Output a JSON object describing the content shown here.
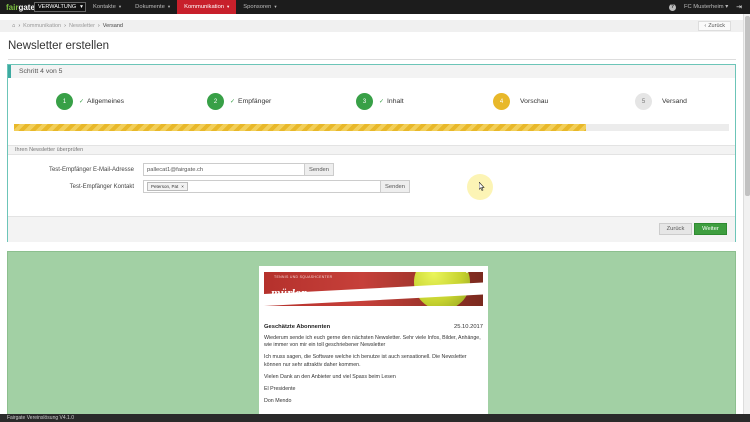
{
  "nav": {
    "logo_prefix": "fair",
    "logo_suffix": "gate",
    "module_select": "VERWALTUNG",
    "items": [
      {
        "label": "Kontakte"
      },
      {
        "label": "Dokumente"
      },
      {
        "label": "Kommunikation"
      },
      {
        "label": "Sponsoren"
      }
    ],
    "help_icon": "question-icon",
    "club": "FC Musterheim",
    "logout_icon": "sign-out-icon",
    "accent_color": "#c8202b"
  },
  "breadcrumb": {
    "home_icon": "home-icon",
    "items": [
      "Kommunikation",
      "Newsletter",
      "Versand"
    ],
    "back_label": "Zurück"
  },
  "page": {
    "title": "Newsletter erstellen"
  },
  "wizard": {
    "step_indicator": "Schritt 4 von 5",
    "steps": [
      {
        "num": "1",
        "label": "Allgemeines",
        "status": "done"
      },
      {
        "num": "2",
        "label": "Empfänger",
        "status": "done"
      },
      {
        "num": "3",
        "label": "Inhalt",
        "status": "done"
      },
      {
        "num": "4",
        "label": "Vorschau",
        "status": "current"
      },
      {
        "num": "5",
        "label": "Versand",
        "status": "todo"
      }
    ],
    "progress": 0.8,
    "review_heading": "Ihren Newsletter überprüfen",
    "email_label": "Test-Empfänger E-Mail-Adresse",
    "email_value": "pallecat1@fairgate.ch",
    "email_send": "Senden",
    "contact_label": "Test-Empfänger Kontakt",
    "contact_tag": "Peterson, Pat",
    "contact_send": "Senden",
    "back_button": "Zurück",
    "next_button": "Weiter"
  },
  "preview": {
    "banner_top": "TENNIS UND SQUASHCENTER",
    "banner_brand": "mürlen",
    "greeting": "Geschätzte Abonnenten",
    "date": "25.10.2017",
    "paragraphs": [
      "Wiederum sende ich euch gerne den nächsten Newsletter. Sehr viele Infos, Bilder, Anhänge, wie immer von mir ein toll geschriebener Newsletter",
      "Ich muss sagen, die Software welche ich benutze ist auch sensationell. Die Newsletter können nur sehr attraktiv daher kommen.",
      "Vielen Dank an den Anbieter und viel Spass beim Lesen",
      "El Presidente",
      "Don Mendo"
    ]
  },
  "footer": {
    "text": "Fairgate Vereinslösung V4.1.0"
  }
}
